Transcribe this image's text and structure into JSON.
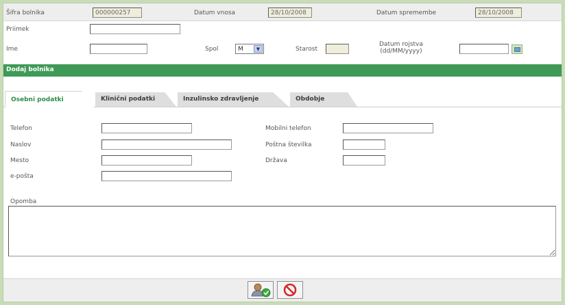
{
  "header": {
    "sifra_label": "Šifra bolnika",
    "sifra_value": "000000257",
    "datum_vnosa_label": "Datum vnosa",
    "datum_vnosa_value": "28/10/2008",
    "datum_spremembe_label": "Datum spremembe",
    "datum_spremembe_value": "28/10/2008",
    "priimek_label": "Priimek",
    "ime_label": "Ime",
    "spol_label": "Spol",
    "spol_value": "M",
    "starost_label": "Starost",
    "datum_rojstva_label": "Datum rojstva",
    "datum_rojstva_format": "(dd/MM/yyyy)"
  },
  "section_title": "Dodaj bolnika",
  "tabs": [
    {
      "label": "Osebni podatki"
    },
    {
      "label": "Klinični podatki"
    },
    {
      "label": "Inzulinsko zdravljenje"
    },
    {
      "label": "Obdobje"
    }
  ],
  "form": {
    "telefon_label": "Telefon",
    "naslov_label": "Naslov",
    "mesto_label": "Mesto",
    "eposta_label": "e-pošta",
    "mobilni_label": "Mobilni telefon",
    "postna_label": "Poštna številka",
    "drzava_label": "Država",
    "opomba_label": "Opomba"
  },
  "icons": {
    "save": "add-user-check-icon",
    "cancel": "cancel-circle-icon",
    "calendar": "calendar-icon",
    "dropdown": "chevron-down-icon"
  },
  "colors": {
    "accent_green": "#3f9a57",
    "tab_active_text": "#2e8b4a",
    "cancel_red": "#d42a2a"
  }
}
